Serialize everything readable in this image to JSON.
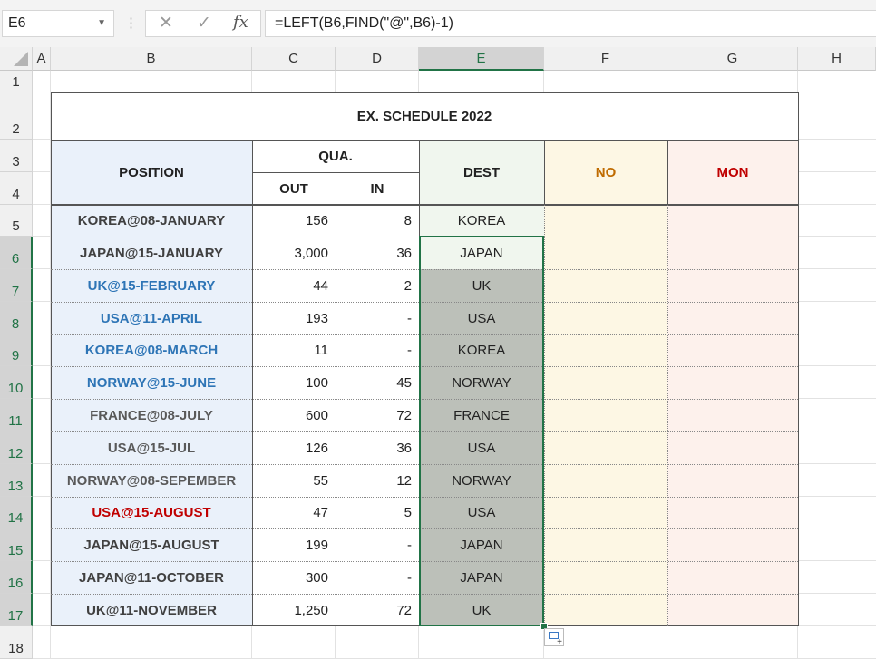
{
  "formula_bar": {
    "name_box": "E6",
    "formula": "=LEFT(B6,FIND(\"@\",B6)-1)",
    "fx_label": "fx",
    "cancel_glyph": "✕",
    "enter_glyph": "✓"
  },
  "columns": [
    "A",
    "B",
    "C",
    "D",
    "E",
    "F",
    "G",
    "H"
  ],
  "rows": [
    "1",
    "2",
    "3",
    "4",
    "5",
    "6",
    "7",
    "8",
    "9",
    "10",
    "11",
    "12",
    "13",
    "14",
    "15",
    "16",
    "17",
    "18"
  ],
  "table": {
    "title": "EX. SCHEDULE 2022",
    "headers": {
      "position": "POSITION",
      "qua": "QUA.",
      "out": "OUT",
      "in": "IN",
      "dest": "DEST",
      "no": "NO",
      "mon": "MON"
    },
    "data": [
      {
        "position": "KOREA@08-JANUARY",
        "out": "156",
        "in": "8",
        "dest": "KOREA",
        "pos_color": "#404040"
      },
      {
        "position": "JAPAN@15-JANUARY",
        "out": "3,000",
        "in": "36",
        "dest": "JAPAN",
        "pos_color": "#404040"
      },
      {
        "position": "UK@15-FEBRUARY",
        "out": "44",
        "in": "2",
        "dest": "UK",
        "pos_color": "#2e75b6"
      },
      {
        "position": "USA@11-APRIL",
        "out": "193",
        "in": "-",
        "dest": "USA",
        "pos_color": "#2e75b6"
      },
      {
        "position": "KOREA@08-MARCH",
        "out": "11",
        "in": "-",
        "dest": "KOREA",
        "pos_color": "#2e75b6"
      },
      {
        "position": "NORWAY@15-JUNE",
        "out": "100",
        "in": "45",
        "dest": "NORWAY",
        "pos_color": "#2e75b6"
      },
      {
        "position": "FRANCE@08-JULY",
        "out": "600",
        "in": "72",
        "dest": "FRANCE",
        "pos_color": "#595959"
      },
      {
        "position": "USA@15-JUL",
        "out": "126",
        "in": "36",
        "dest": "USA",
        "pos_color": "#595959"
      },
      {
        "position": "NORWAY@08-SEPEMBER",
        "out": "55",
        "in": "12",
        "dest": "NORWAY",
        "pos_color": "#595959"
      },
      {
        "position": "USA@15-AUGUST",
        "out": "47",
        "in": "5",
        "dest": "USA",
        "pos_color": "#c00000"
      },
      {
        "position": "JAPAN@15-AUGUST",
        "out": "199",
        "in": "-",
        "dest": "JAPAN",
        "pos_color": "#404040"
      },
      {
        "position": "JAPAN@11-OCTOBER",
        "out": "300",
        "in": "-",
        "dest": "JAPAN",
        "pos_color": "#404040"
      },
      {
        "position": "UK@11-NOVEMBER",
        "out": "1,250",
        "in": "72",
        "dest": "UK",
        "pos_color": "#404040"
      }
    ]
  },
  "colors": {
    "position_bg": "#eaf1fa",
    "dest_bg": "#f0f6ee",
    "no_bg": "#fdf7e4",
    "mon_bg": "#fdf1ec",
    "no_header": "#bf6b00",
    "mon_header": "#c00000",
    "selected_cell_bg": "#f0f6ee",
    "selected_range_bg": "#bcc0b9",
    "accent": "#217346"
  },
  "selection": {
    "active_cell": "E6",
    "range": "E6:E17"
  }
}
